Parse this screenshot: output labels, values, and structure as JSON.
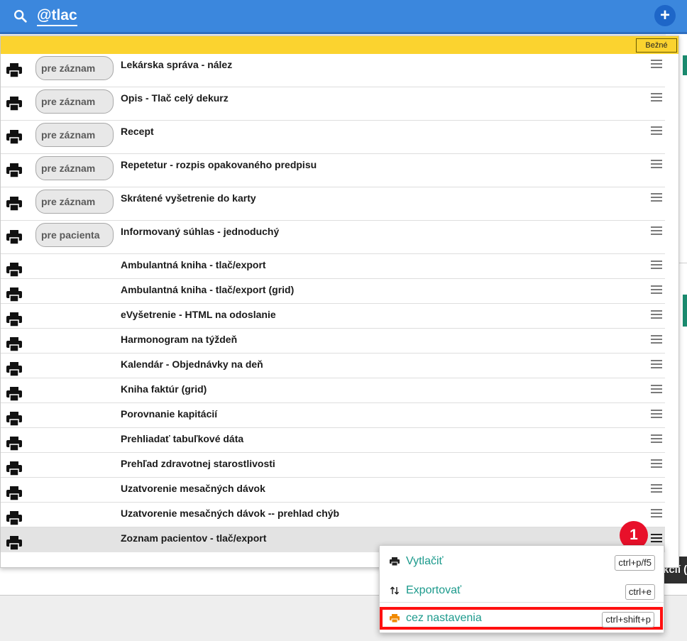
{
  "search": {
    "query": "@tlac"
  },
  "header": {
    "add_label": "+"
  },
  "filter": {
    "button_label": "Bežné"
  },
  "list": {
    "rows": [
      {
        "tag": "pre záznam",
        "title": "Lekárska správa - nález"
      },
      {
        "tag": "pre záznam",
        "title": "Opis - Tlač celý dekurz"
      },
      {
        "tag": "pre záznam",
        "title": "Recept"
      },
      {
        "tag": "pre záznam",
        "title": "Repetetur - rozpis opakovaného predpisu"
      },
      {
        "tag": "pre záznam",
        "title": "Skrátené vyšetrenie do karty"
      },
      {
        "tag": "pre pacienta",
        "title": "Informovaný súhlas - jednoduchý"
      },
      {
        "title": "Ambulantná kniha - tlač/export"
      },
      {
        "title": "Ambulantná kniha - tlač/export (grid)"
      },
      {
        "title": "eVyšetrenie - HTML na odoslanie"
      },
      {
        "title": "Harmonogram na týždeň"
      },
      {
        "title": "Kalendár - Objednávky na deň"
      },
      {
        "title": "Kniha faktúr (grid)"
      },
      {
        "title": "Porovnanie kapitácií"
      },
      {
        "title": "Prehliadať tabuľkové dáta"
      },
      {
        "title": "Prehľad zdravotnej starostlivosti"
      },
      {
        "title": "Uzatvorenie mesačných dávok"
      },
      {
        "title": "Uzatvorenie mesačných dávok -- prehlad chýb"
      },
      {
        "title": "Zoznam pacientov - tlač/export"
      }
    ]
  },
  "annotation": {
    "badge": "1"
  },
  "context_menu": {
    "items": [
      {
        "label": "Vytlačiť",
        "shortcut": "ctrl+p/f5",
        "icon": "printer-icon"
      },
      {
        "label": "Exportovať",
        "shortcut": "ctrl+e",
        "icon": "sort-arrows-icon"
      },
      {
        "label": "cez nastavenia",
        "shortcut": "ctrl+shift+p",
        "icon": "printer-settings-icon"
      }
    ]
  },
  "background": {
    "tooltip_fragment": "kcií (a"
  },
  "colors": {
    "header_blue": "#3b87dd",
    "filter_yellow": "#fbd32f",
    "menu_teal": "#1c9a8c",
    "highlight_red": "#ff1010",
    "badge_red": "#e8102a"
  }
}
